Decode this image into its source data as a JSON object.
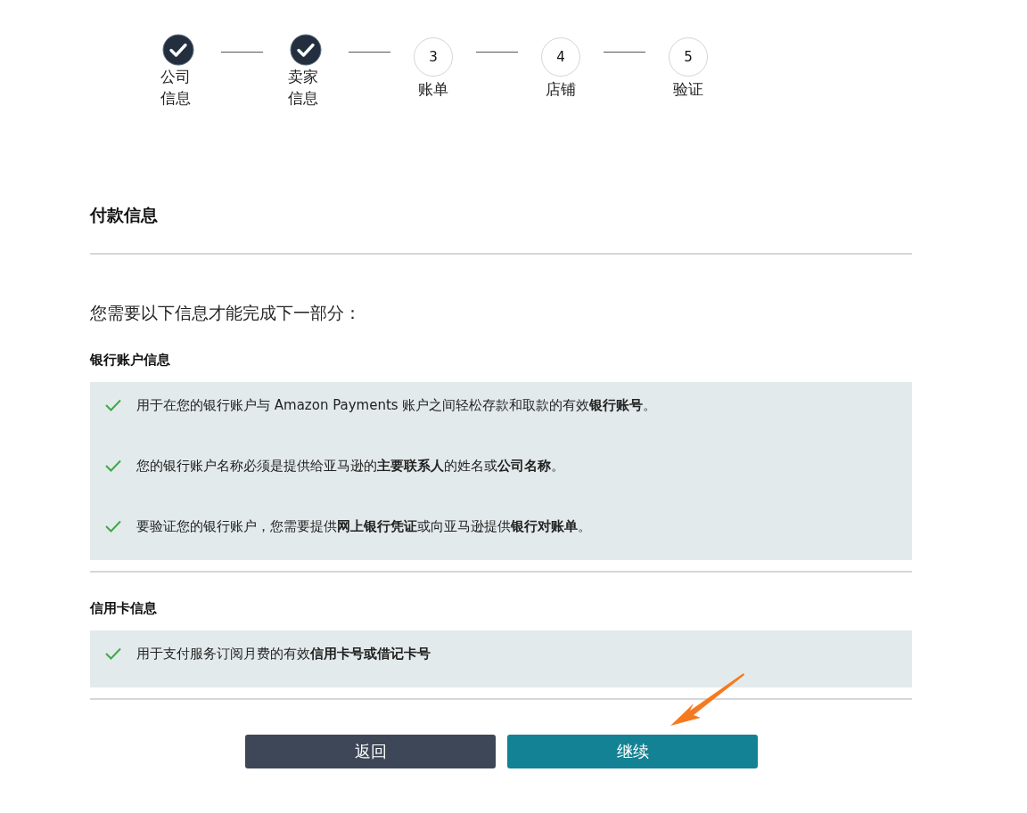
{
  "steps": [
    {
      "label": "公司信息",
      "done": true
    },
    {
      "label": "卖家信息",
      "done": true
    },
    {
      "number": "3",
      "label": "账单",
      "done": false
    },
    {
      "number": "4",
      "label": "店铺",
      "done": false
    },
    {
      "number": "5",
      "label": "验证",
      "done": false
    }
  ],
  "title": "付款信息",
  "intro": "您需要以下信息才能完成下一部分：",
  "sections": [
    {
      "heading": "银行账户信息",
      "items": [
        "用于在您的银行账户与 Amazon Payments 账户之间轻松存款和取款的有效**银行账号**。",
        "您的银行账户名称必须是提供给亚马逊的**主要联系人**的姓名或**公司名称**。",
        "要验证您的银行账户，您需要提供**网上银行凭证**或向亚马逊提供**银行对账单**。"
      ]
    },
    {
      "heading": "信用卡信息",
      "items": [
        "用于支付服务订阅月费的有效**信用卡号或借记卡号**"
      ]
    }
  ],
  "buttons": [
    {
      "label": "返回",
      "kind": "secondary"
    },
    {
      "label": "继续",
      "kind": "primary"
    }
  ]
}
